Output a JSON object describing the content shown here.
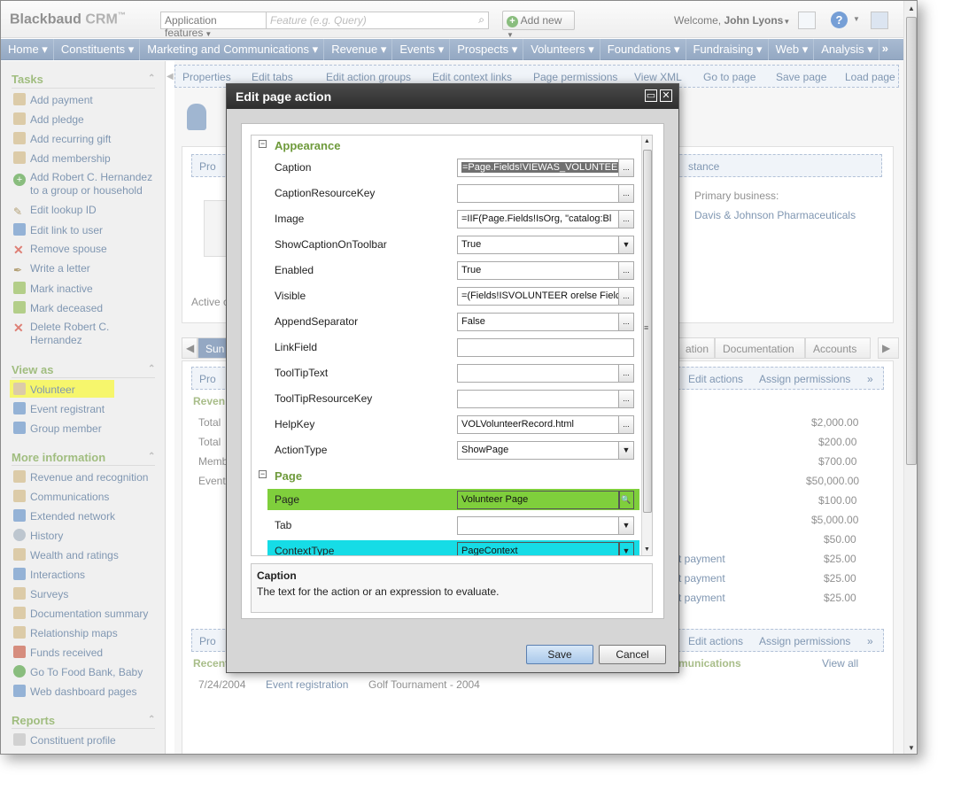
{
  "app": {
    "logo": "Blackbaud",
    "logo_suffix": "CRM",
    "logo_tm": "™"
  },
  "header": {
    "app_selector": "Application features",
    "search_placeholder": "Feature (e.g. Query)",
    "add_new": "Add new",
    "welcome_prefix": "Welcome, ",
    "user_name": "John Lyons"
  },
  "nav": {
    "items": [
      "Home",
      "Constituents",
      "Marketing and Communications",
      "Revenue",
      "Events",
      "Prospects",
      "Volunteers",
      "Foundations",
      "Fundraising",
      "Web",
      "Analysis"
    ],
    "more": "»"
  },
  "sidebar": {
    "tasks_title": "Tasks",
    "tasks": [
      "Add payment",
      "Add pledge",
      "Add recurring gift",
      "Add membership",
      "Add Robert C. Hernandez",
      "to a group or household",
      "Edit lookup ID",
      "Edit link to user",
      "Remove spouse",
      "Write a letter",
      "Mark inactive",
      "Mark deceased",
      "Delete Robert C.",
      "Hernandez"
    ],
    "viewas_title": "View as",
    "viewas": [
      "Volunteer",
      "Event registrant",
      "Group member"
    ],
    "more_title": "More information",
    "more": [
      "Revenue and recognition",
      "Communications",
      "Extended network",
      "History",
      "Wealth and ratings",
      "Interactions",
      "Surveys",
      "Documentation summary",
      "Relationship maps",
      "Funds received",
      "Go To Food Bank, Baby",
      "Web dashboard pages"
    ],
    "reports_title": "Reports",
    "reports": [
      "Constituent profile"
    ]
  },
  "page_toolbar": [
    "Properties",
    "Edit tabs",
    "Edit action groups",
    "Edit context links",
    "Page permissions",
    "View XML",
    "Go to page",
    "Save page",
    "Load page"
  ],
  "background": {
    "stance_fragment": "stance",
    "primary_business_label": "Primary business:",
    "primary_business_value": "Davis & Johnson Pharmaceuticals",
    "active_fragment": "Active c",
    "tabs_fragment": [
      "Sun",
      "ation",
      "Documentation",
      "Accounts"
    ],
    "edit_actions": "Edit actions",
    "assign_permissions": "Assign permissions",
    "proc_fragment": "Pro",
    "revenue_fragment": "Reven",
    "row_labels": [
      "Total",
      "Total",
      "Memb",
      "Event"
    ],
    "amounts": [
      "$2,000.00",
      "$200.00",
      "$700.00",
      "$50,000.00",
      "$100.00",
      "$5,000.00",
      "$50.00",
      "$25.00",
      "$25.00",
      "$25.00"
    ],
    "payment_fragments": [
      "t payment",
      "t payment",
      "t payment"
    ],
    "recent_fragment": "Recent",
    "communications_fragment": "munications",
    "view_all": "View all",
    "recent_row": {
      "date": "7/24/2004",
      "type": "Event registration",
      "name": "Golf Tournament - 2004"
    }
  },
  "dialog": {
    "title": "Edit page action",
    "categories": {
      "appearance": "Appearance",
      "page": "Page"
    },
    "properties": [
      {
        "name": "Caption",
        "value": "=Page.Fields!VIEWAS_VOLUNTEER",
        "btn": "..."
      },
      {
        "name": "CaptionResourceKey",
        "value": "",
        "btn": "..."
      },
      {
        "name": "Image",
        "value": "=IIF(Page.Fields!IsOrg, \"catalog:Bl",
        "btn": "..."
      },
      {
        "name": "ShowCaptionOnToolbar",
        "value": "True",
        "btn": "▼"
      },
      {
        "name": "Enabled",
        "value": "True",
        "btn": "..."
      },
      {
        "name": "Visible",
        "value": "=(Fields!ISVOLUNTEER orelse Fielc",
        "btn": "..."
      },
      {
        "name": "AppendSeparator",
        "value": "False",
        "btn": "..."
      },
      {
        "name": "LinkField",
        "value": "",
        "btn": ""
      },
      {
        "name": "ToolTipText",
        "value": "",
        "btn": "..."
      },
      {
        "name": "ToolTipResourceKey",
        "value": "",
        "btn": "..."
      },
      {
        "name": "HelpKey",
        "value": "VOLVolunteerRecord.html",
        "btn": "..."
      },
      {
        "name": "ActionType",
        "value": "ShowPage",
        "btn": "▼"
      }
    ],
    "page_properties": [
      {
        "name": "Page",
        "value": "Volunteer Page",
        "btn": "🔍"
      },
      {
        "name": "Tab",
        "value": "",
        "btn": "▼"
      },
      {
        "name": "ContextType",
        "value": "PageContext",
        "btn": "▼"
      }
    ],
    "description_title": "Caption",
    "description_text": "The text for the action or an expression to evaluate.",
    "save": "Save",
    "cancel": "Cancel"
  },
  "colors": {
    "nav": "#5b7aa3",
    "green_heading": "#6e9a3b",
    "page_row": "#7fcf3c",
    "context_row": "#16dce6",
    "highlight": "#f2f21e"
  }
}
